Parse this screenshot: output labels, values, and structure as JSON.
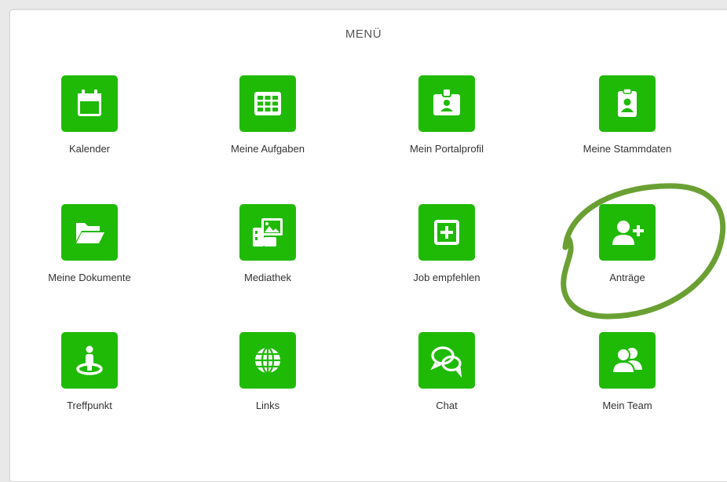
{
  "menu": {
    "title": "MENÜ",
    "accent_color": "#1fba05",
    "annotation_color": "#6aa033",
    "items": [
      {
        "label": "Kalender",
        "icon": "calendar-icon"
      },
      {
        "label": "Meine Aufgaben",
        "icon": "grid-icon"
      },
      {
        "label": "Mein Portalprofil",
        "icon": "id-badge-icon"
      },
      {
        "label": "Meine Stammdaten",
        "icon": "clipboard-user-icon"
      },
      {
        "label": "Meine Dokumente",
        "icon": "folder-open-icon"
      },
      {
        "label": "Mediathek",
        "icon": "photo-gallery-icon"
      },
      {
        "label": "Job empfehlen",
        "icon": "plus-square-icon"
      },
      {
        "label": "Anträge",
        "icon": "user-plus-icon"
      },
      {
        "label": "Treffpunkt",
        "icon": "meeting-point-icon"
      },
      {
        "label": "Links",
        "icon": "globe-icon"
      },
      {
        "label": "Chat",
        "icon": "chat-bubbles-icon"
      },
      {
        "label": "Mein Team",
        "icon": "team-icon"
      }
    ]
  }
}
